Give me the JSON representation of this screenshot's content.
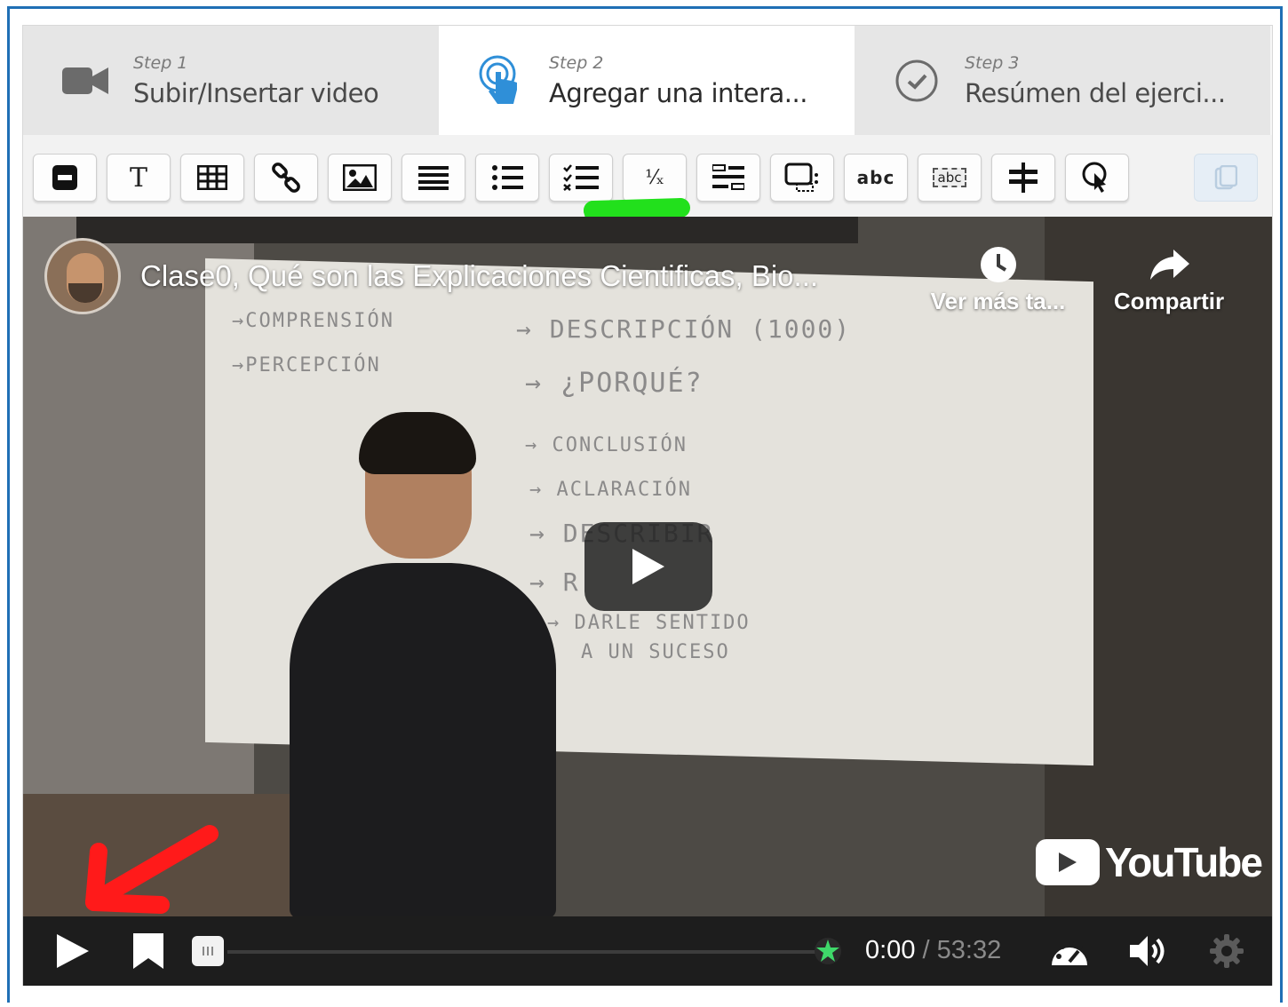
{
  "steps": [
    {
      "num": "Step 1",
      "title": "Subir/Insertar video",
      "icon": "video-camera-icon"
    },
    {
      "num": "Step 2",
      "title": "Agregar una intera...",
      "icon": "touch-pointer-icon"
    },
    {
      "num": "Step 3",
      "title": "Resúmen del ejerci...",
      "icon": "check-circle-icon"
    }
  ],
  "toolbar": {
    "tools": [
      "minus-icon",
      "text-icon",
      "table-icon",
      "link-icon",
      "image-icon",
      "list-icon",
      "ordered-list-icon",
      "checklist-icon",
      "fraction-icon",
      "drag-text-icon",
      "hotspot-icon",
      "mark-words-icon",
      "fill-blanks-icon",
      "navigation-icon",
      "crosshair-pointer-icon",
      "paste-icon"
    ],
    "text_tool_label": "T",
    "mark_words_label": "abc",
    "fill_blanks_label": "abc",
    "fraction_label": "⅟ₓ"
  },
  "video": {
    "title": "Clase0, Qué son las Explicaciones Cientificas, Bio...",
    "watch_later": "Ver más ta...",
    "share": "Compartir",
    "brand": "YouTube",
    "board_lines": [
      "→COMPRENSIÓN",
      "→PERCEPCIÓN",
      "→ DESCRIPCIÓN (1000)",
      "→ ¿PORQUÉ?",
      "→ CONCLUSIÓN",
      "→ ACLARACIÓN",
      "→ DESCRIBIR",
      "→ R",
      "→ DARLE SENTIDO",
      "A UN SUCESO"
    ]
  },
  "player": {
    "current_time": "0:00",
    "separator": "/",
    "duration": "53:32"
  },
  "colors": {
    "frame_border": "#1f6fb5",
    "step_active_icon": "#2f8fd8",
    "green_arrow": "#22e01c",
    "red_arrow": "#ff1a1a"
  }
}
